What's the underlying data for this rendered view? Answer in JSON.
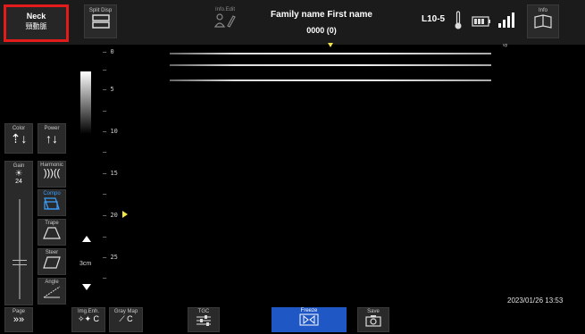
{
  "header": {
    "preset_line1": "Neck",
    "preset_line2": "頸動脈",
    "split_disp": "Split Disp",
    "info_edit": "Info.Edit",
    "patient_name": "Family name First name",
    "patient_id": "0000 (0)",
    "probe": "L10-5",
    "info": "Info"
  },
  "left_panel": {
    "color": "Color",
    "power": "Power",
    "gain": "Gain",
    "gain_value": "24",
    "harmonic": "Harmonic",
    "compo": "Compo",
    "trape": "Trape",
    "steer": "Steer",
    "angle": "Angle",
    "page": "Page"
  },
  "image_area": {
    "depth_labels": [
      "0",
      "5",
      "10",
      "15",
      "20",
      "25"
    ],
    "scale_label": "3cm",
    "vp_label": "vp"
  },
  "bottom": {
    "img_enh": "Img.Enh.",
    "gray_map": "Gray Map",
    "tgc": "TGC",
    "freeze": "Freeze",
    "save": "Save",
    "datetime": "2023/01/26 13:53",
    "c_label": "C"
  },
  "colors": {
    "highlight": "#e31b1b",
    "accent_blue": "#1f57c4",
    "focus_yellow": "#f2e34a",
    "compo_blue": "#3aa0ff"
  }
}
